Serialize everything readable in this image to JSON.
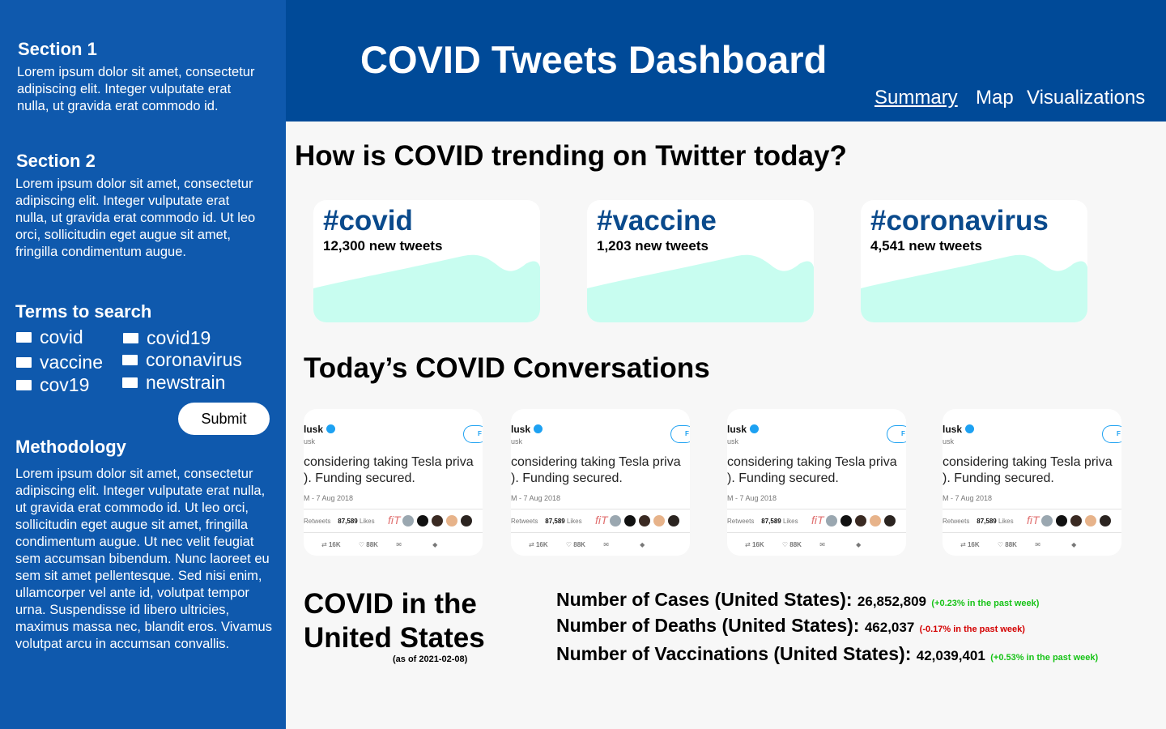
{
  "sidebar": {
    "section1": {
      "title": "Section 1",
      "text": "Lorem ipsum dolor sit amet, consectetur adipiscing elit. Integer vulputate erat nulla, ut gravida erat commodo id."
    },
    "section2": {
      "title": "Section 2",
      "text": "Lorem ipsum dolor sit amet, consectetur adipiscing elit. Integer vulputate erat nulla, ut gravida erat commodo id. Ut leo orci, sollicitudin eget augue sit amet, fringilla condimentum augue."
    },
    "terms_title": "Terms to search",
    "terms": [
      "covid",
      "covid19",
      "vaccine",
      "coronavirus",
      "cov19",
      "newstrain"
    ],
    "submit_label": "Submit",
    "methodology": {
      "title": "Methodology",
      "text": "Lorem ipsum dolor sit amet, consectetur adipiscing elit. Integer vulputate erat nulla, ut gravida erat commodo id. Ut leo orci, sollicitudin eget augue sit amet, fringilla condimentum augue. Ut nec velit feugiat sem accumsan bibendum. Nunc laoreet eu sem sit amet pellentesque. Sed nisi enim, ullamcorper vel ante id, volutpat tempor urna. Suspendisse id libero ultricies, maximus massa nec, blandit eros. Vivamus volutpat arcu in accumsan convallis."
    }
  },
  "header": {
    "title": "COVID Tweets Dashboard",
    "nav": [
      "Summary",
      "Map",
      "Visualizations"
    ],
    "active_nav": "Summary"
  },
  "trending": {
    "heading": "How is COVID trending on Twitter today?",
    "cards": [
      {
        "tag": "#covid",
        "count": "12,300 new tweets"
      },
      {
        "tag": "#vaccine",
        "count": "1,203 new tweets"
      },
      {
        "tag": "#coronavirus",
        "count": "4,541 new tweets"
      }
    ],
    "wave_color": "#c8fdf0"
  },
  "conversations": {
    "heading": "Today’s COVID Conversations",
    "tweets": [
      {
        "name": "lusk",
        "handle": "usk",
        "text_line1": "considering taking Tesla priva",
        "text_line2": "). Funding secured.",
        "date": "M - 7 Aug 2018",
        "retweets_label": "Retweets",
        "likes_value": "87,589",
        "likes_label": "Likes",
        "reply_count": "16K",
        "like_count": "88K"
      },
      {
        "name": "lusk",
        "handle": "usk",
        "text_line1": "considering taking Tesla priva",
        "text_line2": "). Funding secured.",
        "date": "M - 7 Aug 2018",
        "retweets_label": "Retweets",
        "likes_value": "87,589",
        "likes_label": "Likes",
        "reply_count": "16K",
        "like_count": "88K"
      },
      {
        "name": "lusk",
        "handle": "usk",
        "text_line1": "considering taking Tesla priva",
        "text_line2": "). Funding secured.",
        "date": "M - 7 Aug 2018",
        "retweets_label": "Retweets",
        "likes_value": "87,589",
        "likes_label": "Likes",
        "reply_count": "16K",
        "like_count": "88K"
      },
      {
        "name": "lusk",
        "handle": "usk",
        "text_line1": "considering taking Tesla priva",
        "text_line2": "). Funding secured.",
        "date": "M - 7 Aug 2018",
        "retweets_label": "Retweets",
        "likes_value": "87,589",
        "likes_label": "Likes",
        "reply_count": "16K",
        "like_count": "88K"
      }
    ],
    "follow_label": "F",
    "fit_label": "fiT"
  },
  "us": {
    "title_line1": "COVID in the",
    "title_line2": "United States",
    "as_of": "(as of 2021-02-08)",
    "stats": [
      {
        "label": "Number of Cases (United States):",
        "value": "26,852,809",
        "change": "(+0.23% in the past week)",
        "trend": "pos"
      },
      {
        "label": "Number of Deaths (United States):",
        "value": "462,037",
        "change": "(-0.17% in the past week)",
        "trend": "neg"
      },
      {
        "label": "Number of Vaccinations (United States):",
        "value": "42,039,401",
        "change": "(+0.53% in the past week)",
        "trend": "pos"
      }
    ]
  },
  "colors": {
    "sidebar": "#0f59ad",
    "header": "#004a98",
    "positive": "#16c316",
    "negative": "#d40000",
    "hashtag": "#0a4a8c"
  }
}
